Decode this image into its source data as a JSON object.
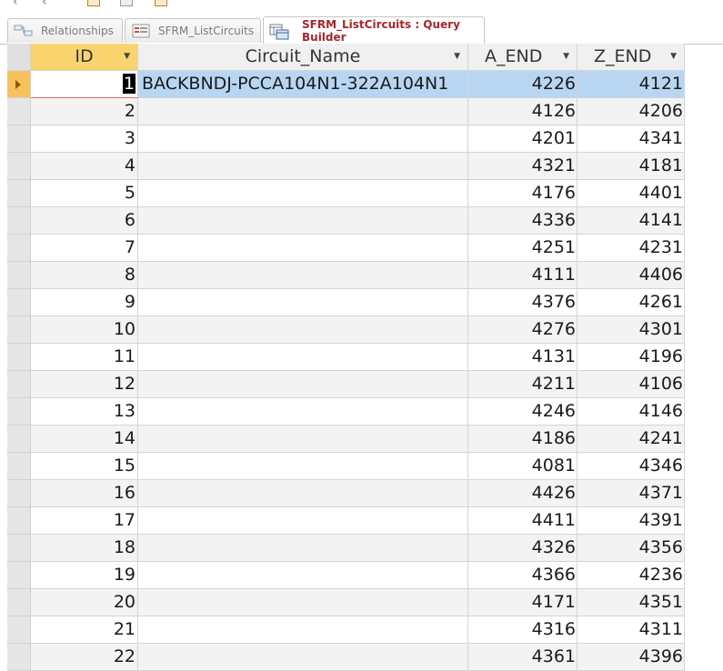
{
  "tabs": [
    {
      "label": "Relationships",
      "icon": "relationships-icon",
      "active": false
    },
    {
      "label": "SFRM_ListCircuits",
      "icon": "form-icon",
      "active": false
    },
    {
      "label": "SFRM_ListCircuits : Query Builder",
      "icon": "query-icon",
      "active": true
    }
  ],
  "columns": {
    "id": "ID",
    "name": "Circuit_Name",
    "a_end": "A_END",
    "z_end": "Z_END"
  },
  "rows": [
    {
      "id": "1",
      "name": "BACKBNDJ-PCCA104N1-322A104N1",
      "a": "4226",
      "z": "4121"
    },
    {
      "id": "2",
      "name": "",
      "a": "4126",
      "z": "4206"
    },
    {
      "id": "3",
      "name": "",
      "a": "4201",
      "z": "4341"
    },
    {
      "id": "4",
      "name": "",
      "a": "4321",
      "z": "4181"
    },
    {
      "id": "5",
      "name": "",
      "a": "4176",
      "z": "4401"
    },
    {
      "id": "6",
      "name": "",
      "a": "4336",
      "z": "4141"
    },
    {
      "id": "7",
      "name": "",
      "a": "4251",
      "z": "4231"
    },
    {
      "id": "8",
      "name": "",
      "a": "4111",
      "z": "4406"
    },
    {
      "id": "9",
      "name": "",
      "a": "4376",
      "z": "4261"
    },
    {
      "id": "10",
      "name": "",
      "a": "4276",
      "z": "4301"
    },
    {
      "id": "11",
      "name": "",
      "a": "4131",
      "z": "4196"
    },
    {
      "id": "12",
      "name": "",
      "a": "4211",
      "z": "4106"
    },
    {
      "id": "13",
      "name": "",
      "a": "4246",
      "z": "4146"
    },
    {
      "id": "14",
      "name": "",
      "a": "4186",
      "z": "4241"
    },
    {
      "id": "15",
      "name": "",
      "a": "4081",
      "z": "4346"
    },
    {
      "id": "16",
      "name": "",
      "a": "4426",
      "z": "4371"
    },
    {
      "id": "17",
      "name": "",
      "a": "4411",
      "z": "4391"
    },
    {
      "id": "18",
      "name": "",
      "a": "4326",
      "z": "4356"
    },
    {
      "id": "19",
      "name": "",
      "a": "4366",
      "z": "4236"
    },
    {
      "id": "20",
      "name": "",
      "a": "4171",
      "z": "4351"
    },
    {
      "id": "21",
      "name": "",
      "a": "4316",
      "z": "4311"
    },
    {
      "id": "22",
      "name": "",
      "a": "4361",
      "z": "4396"
    }
  ],
  "colors": {
    "active_tab_text": "#a4262c",
    "selected_row": "#b8d6f2",
    "id_header": "#f9d46e",
    "record_selector_active": "#f7c15d"
  }
}
